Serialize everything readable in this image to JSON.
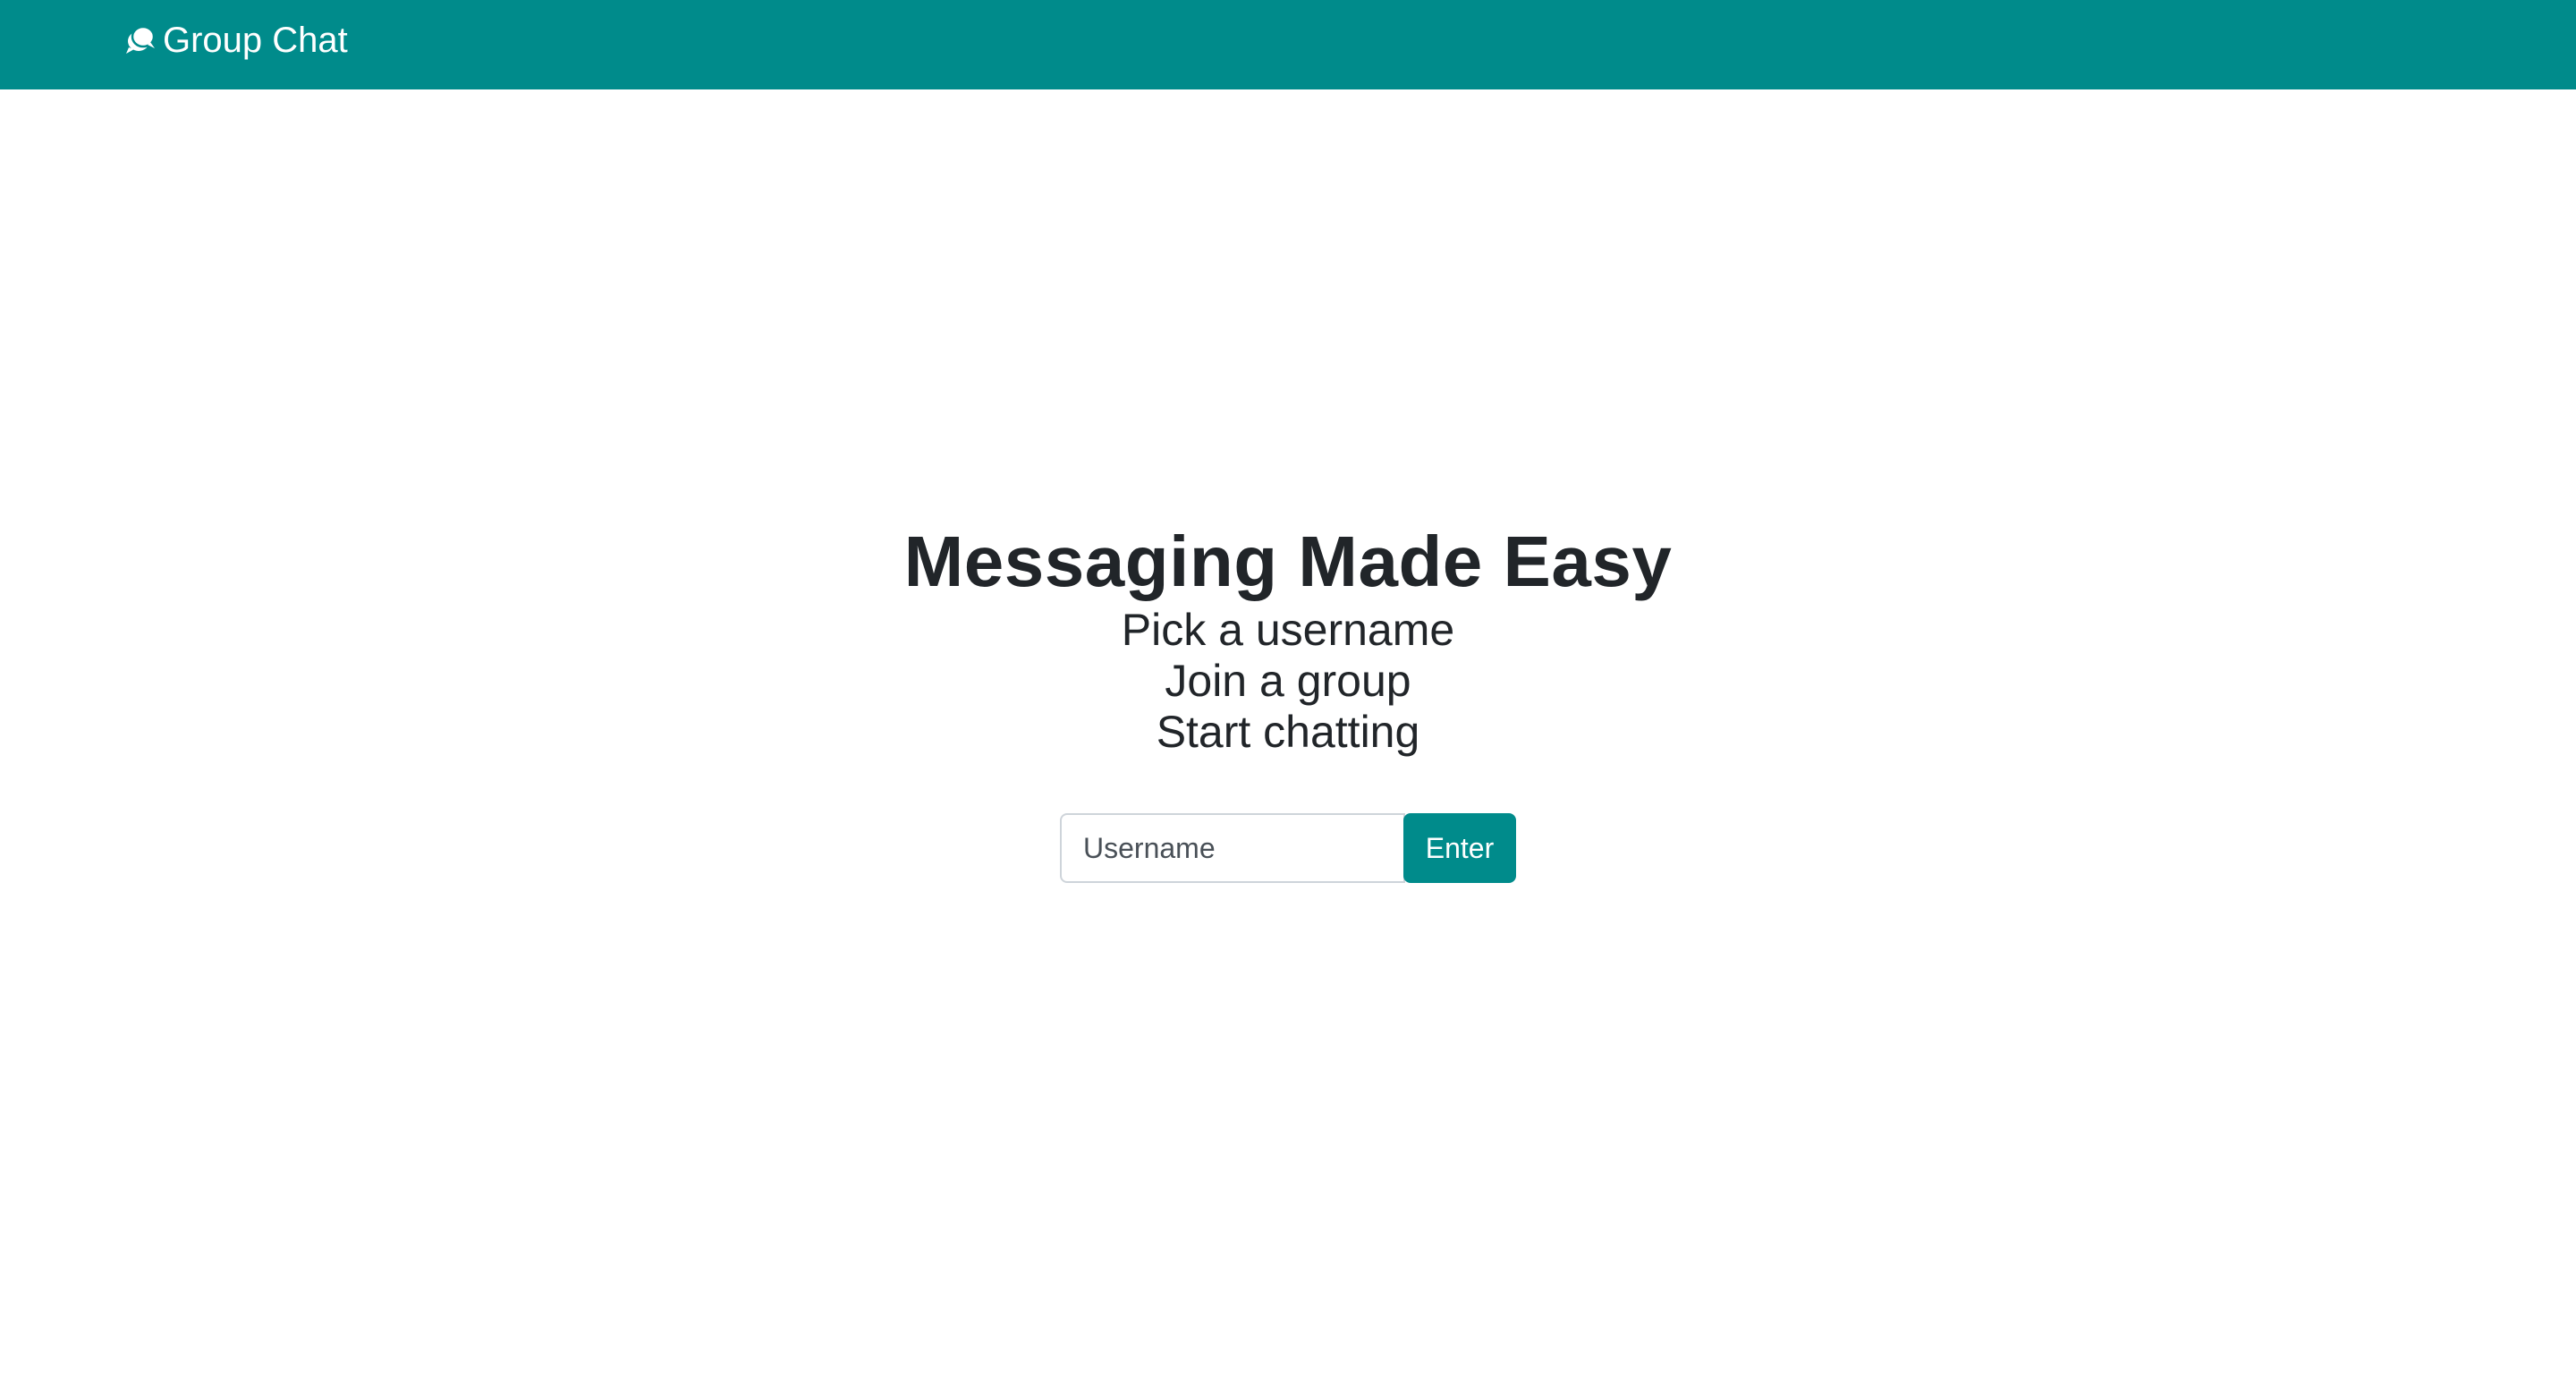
{
  "navbar": {
    "brand_label": "Group Chat",
    "brand_icon": "chat-bubbles-icon",
    "background_color": "#008b8b"
  },
  "hero": {
    "title": "Messaging Made Easy",
    "taglines": [
      "Pick a username",
      "Join a group",
      "Start chatting"
    ]
  },
  "login_form": {
    "username_placeholder": "Username",
    "username_value": "",
    "enter_label": "Enter",
    "accent_color": "#008b8b"
  }
}
